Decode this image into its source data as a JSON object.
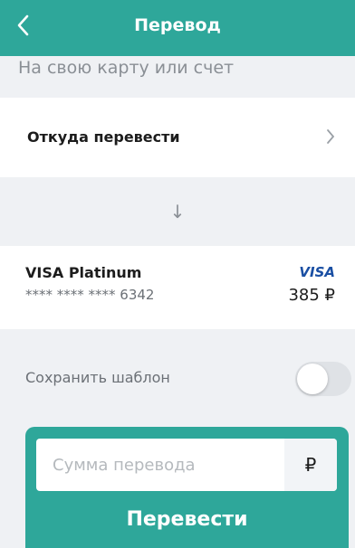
{
  "header": {
    "title": "Перевод",
    "back_icon": "chevron-left-icon",
    "color": "#2ea79a"
  },
  "subtitle": "На свою карту или счет",
  "from": {
    "label": "Откуда перевести",
    "chevron_icon": "chevron-right-icon"
  },
  "arrow": "↓",
  "card": {
    "name": "VISA Platinum",
    "number": "**** **** **** 6342",
    "brand": "VISA",
    "balance": "385 ₽"
  },
  "save_template": {
    "label": "Сохранить шаблон",
    "enabled": false
  },
  "amount": {
    "placeholder": "Сумма перевода",
    "value": "",
    "currency": "₽"
  },
  "submit_label": "Перевести"
}
